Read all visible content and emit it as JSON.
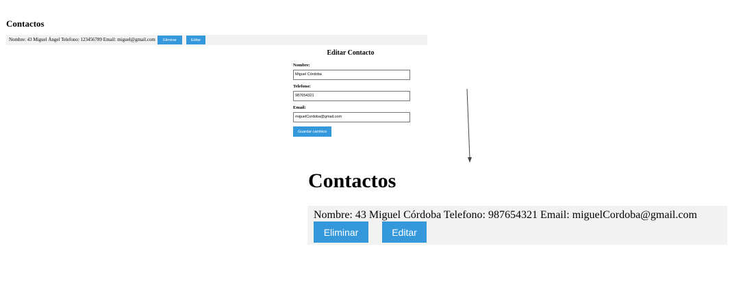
{
  "before": {
    "title": "Contactos",
    "contact_text": "Nombre: 43 Miguel Ángel Telefono: 123456789 Email: miguel@gmail.com",
    "delete_label": "Eliminar",
    "edit_label": "Editar",
    "form": {
      "title": "Editar Contacto",
      "name_label": "Nombre:",
      "name_value": "Miguel Córdoba",
      "phone_label": "Telefono:",
      "phone_value": "987654321",
      "email_label": "Email:",
      "email_value": "miguelCordoba@gmail.com",
      "save_label": "Guardar cambios"
    }
  },
  "after": {
    "title": "Contactos",
    "contact_text": "Nombre: 43 Miguel Córdoba Telefono: 987654321 Email: miguelCordoba@gmail.com",
    "delete_label": "Eliminar",
    "edit_label": "Editar"
  },
  "colors": {
    "button": "#3598db",
    "row_background": "#f2f2f2"
  },
  "icons": {
    "transition": "arrow-down-icon"
  }
}
